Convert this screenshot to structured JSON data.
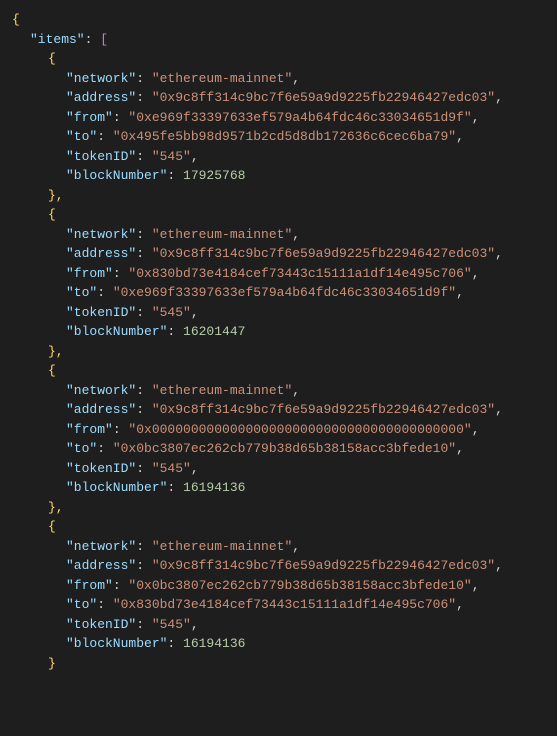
{
  "root_open": "{",
  "items_key": "\"items\"",
  "items_open": "[",
  "obj_open": "{",
  "obj_close_comma": "},",
  "obj_close": "}",
  "colon": ": ",
  "comma": ",",
  "records": [
    {
      "network_key": "\"network\"",
      "network_val": "\"ethereum-mainnet\"",
      "address_key": "\"address\"",
      "address_val": "\"0x9c8ff314c9bc7f6e59a9d9225fb22946427edc03\"",
      "from_key": "\"from\"",
      "from_val": "\"0xe969f33397633ef579a4b64fdc46c33034651d9f\"",
      "to_key": "\"to\"",
      "to_val": "\"0x495fe5bb98d9571b2cd5d8db172636c6cec6ba79\"",
      "tokenID_key": "\"tokenID\"",
      "tokenID_val": "\"545\"",
      "blockNumber_key": "\"blockNumber\"",
      "blockNumber_val": "17925768"
    },
    {
      "network_key": "\"network\"",
      "network_val": "\"ethereum-mainnet\"",
      "address_key": "\"address\"",
      "address_val": "\"0x9c8ff314c9bc7f6e59a9d9225fb22946427edc03\"",
      "from_key": "\"from\"",
      "from_val": "\"0x830bd73e4184cef73443c15111a1df14e495c706\"",
      "to_key": "\"to\"",
      "to_val": "\"0xe969f33397633ef579a4b64fdc46c33034651d9f\"",
      "tokenID_key": "\"tokenID\"",
      "tokenID_val": "\"545\"",
      "blockNumber_key": "\"blockNumber\"",
      "blockNumber_val": "16201447"
    },
    {
      "network_key": "\"network\"",
      "network_val": "\"ethereum-mainnet\"",
      "address_key": "\"address\"",
      "address_val": "\"0x9c8ff314c9bc7f6e59a9d9225fb22946427edc03\"",
      "from_key": "\"from\"",
      "from_val": "\"0x0000000000000000000000000000000000000000\"",
      "to_key": "\"to\"",
      "to_val": "\"0x0bc3807ec262cb779b38d65b38158acc3bfede10\"",
      "tokenID_key": "\"tokenID\"",
      "tokenID_val": "\"545\"",
      "blockNumber_key": "\"blockNumber\"",
      "blockNumber_val": "16194136"
    },
    {
      "network_key": "\"network\"",
      "network_val": "\"ethereum-mainnet\"",
      "address_key": "\"address\"",
      "address_val": "\"0x9c8ff314c9bc7f6e59a9d9225fb22946427edc03\"",
      "from_key": "\"from\"",
      "from_val": "\"0x0bc3807ec262cb779b38d65b38158acc3bfede10\"",
      "to_key": "\"to\"",
      "to_val": "\"0x830bd73e4184cef73443c15111a1df14e495c706\"",
      "tokenID_key": "\"tokenID\"",
      "tokenID_val": "\"545\"",
      "blockNumber_key": "\"blockNumber\"",
      "blockNumber_val": "16194136"
    }
  ]
}
